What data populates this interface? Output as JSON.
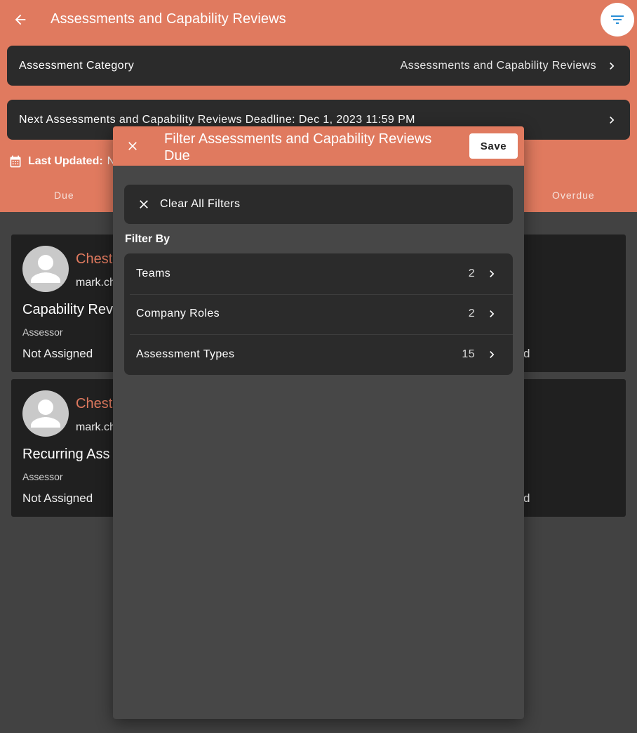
{
  "header": {
    "title": "Assessments and Capability Reviews"
  },
  "assessment_category": {
    "label": "Assessment Category",
    "value": "Assessments and Capability Reviews"
  },
  "deadline": {
    "text": "Next Assessments and Capability Reviews Deadline: Dec 1, 2023 11:59 PM"
  },
  "last_updated": {
    "label": "Last Updated:",
    "value_fragment": "N"
  },
  "tabs": {
    "due": "Due",
    "overdue": "Overdue"
  },
  "cards": [
    {
      "name_fragment": "Chest",
      "email_fragment": "mark.ch",
      "title_fragment": "Capability Rev",
      "assessor_label": "Assessor",
      "assessor_value": "Not Assigned",
      "right_fragment": "d"
    },
    {
      "name_fragment": "Chest",
      "email_fragment": "mark.ch",
      "title_fragment": "Recurring Ass",
      "assessor_label": "Assessor",
      "assessor_value": "Not Assigned",
      "right_fragment": "d"
    }
  ],
  "modal": {
    "title": "Filter Assessments and Capability Reviews Due",
    "save_label": "Save",
    "clear_label": "Clear All Filters",
    "filter_by_label": "Filter By",
    "filters": [
      {
        "name": "Teams",
        "count": "2"
      },
      {
        "name": "Company Roles",
        "count": "2"
      },
      {
        "name": "Assessment Types",
        "count": "15"
      }
    ]
  },
  "colors": {
    "accent": "#e07a5f",
    "surface": "#2b2b2b",
    "card": "#202020",
    "background": "#424242",
    "modal": "#474747"
  }
}
